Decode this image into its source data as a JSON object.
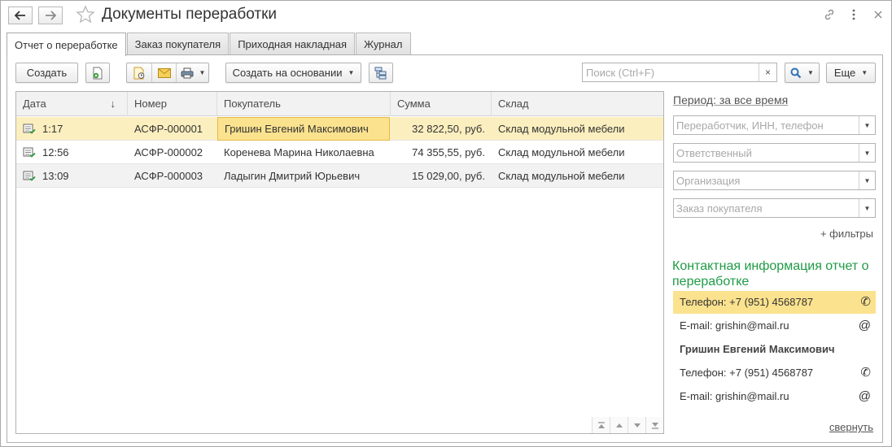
{
  "window": {
    "title": "Документы переработки"
  },
  "tabs": [
    {
      "label": "Отчет о переработке"
    },
    {
      "label": "Заказ покупателя"
    },
    {
      "label": "Приходная накладная"
    },
    {
      "label": "Журнал"
    }
  ],
  "toolbar": {
    "create_label": "Создать",
    "create_based_label": "Создать на основании",
    "more_label": "Еще",
    "search_placeholder": "Поиск (Ctrl+F)",
    "search_clear": "×"
  },
  "grid": {
    "columns": [
      "Дата",
      "Номер",
      "Покупатель",
      "Сумма",
      "Склад"
    ],
    "sort_indicator": "↓",
    "rows": [
      {
        "date": "1:17",
        "number": "АСФР-000001",
        "customer": "Гришин Евгений Максимович",
        "sum": "32 822,50, руб.",
        "warehouse": "Склад модульной мебели"
      },
      {
        "date": "12:56",
        "number": "АСФР-000002",
        "customer": "Коренева Марина Николаевна",
        "sum": "74 355,55, руб.",
        "warehouse": "Склад модульной мебели"
      },
      {
        "date": "13:09",
        "number": "АСФР-000003",
        "customer": "Ладыгин Дмитрий Юрьевич",
        "sum": "15 029,00, руб.",
        "warehouse": "Склад модульной мебели"
      }
    ]
  },
  "filters": {
    "period_label": "Период: за все время",
    "processor_placeholder": "Переработчик, ИНН, телефон",
    "responsible_placeholder": "Ответственный",
    "organization_placeholder": "Организация",
    "order_placeholder": "Заказ покупателя",
    "more_filters_label": "+ фильтры"
  },
  "contacts": {
    "title": "Контактная информация отчет о переработке",
    "phone1": "Телефон: +7 (951) 4568787",
    "email1": "E-mail: grishin@mail.ru",
    "person_name": "Гришин Евгений Максимович",
    "phone2": "Телефон: +7 (951) 4568787",
    "email2": "E-mail: grishin@mail.ru",
    "collapse_label": "свернуть"
  },
  "colors": {
    "selection": "#fcefbf",
    "focus": "#fbe28e",
    "accent_green": "#1e9b45"
  }
}
